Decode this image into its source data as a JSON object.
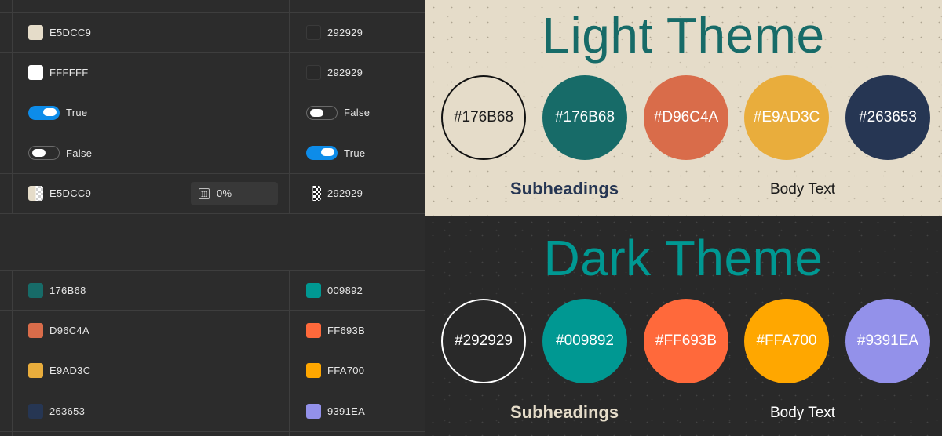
{
  "table": {
    "rows_top": [
      {
        "light": {
          "kind": "color",
          "value": "E5DCC9",
          "swatch": "#e5dcc9"
        },
        "dark": {
          "kind": "color",
          "value": "292929",
          "swatch": "#292929"
        }
      },
      {
        "light": {
          "kind": "color",
          "value": "FFFFFF",
          "swatch": "#ffffff"
        },
        "dark": {
          "kind": "color",
          "value": "292929",
          "swatch": "#292929"
        }
      },
      {
        "light": {
          "kind": "toggle",
          "on": true,
          "value": "True"
        },
        "dark": {
          "kind": "toggle",
          "on": false,
          "value": "False"
        }
      },
      {
        "light": {
          "kind": "toggle",
          "on": false,
          "value": "False"
        },
        "dark": {
          "kind": "toggle",
          "on": true,
          "value": "True"
        }
      },
      {
        "light": {
          "kind": "color-mixed",
          "value": "E5DCC9"
        },
        "opacity": "0%",
        "dark": {
          "kind": "color-mixed",
          "value": "292929"
        }
      }
    ],
    "rows_bottom": [
      {
        "light": {
          "value": "176B68",
          "swatch": "#176b68"
        },
        "dark": {
          "value": "009892",
          "swatch": "#009892"
        }
      },
      {
        "light": {
          "value": "D96C4A",
          "swatch": "#d96c4a"
        },
        "dark": {
          "value": "FF693B",
          "swatch": "#ff693b"
        }
      },
      {
        "light": {
          "value": "E9AD3C",
          "swatch": "#e9ad3c"
        },
        "dark": {
          "value": "FFA700",
          "swatch": "#ffa700"
        }
      },
      {
        "light": {
          "value": "263653",
          "swatch": "#263653"
        },
        "dark": {
          "value": "9391EA",
          "swatch": "#9391ea"
        }
      }
    ]
  },
  "light_theme": {
    "title": "Light Theme",
    "circles": [
      {
        "label": "#176B68",
        "fill": "#e5dcc9",
        "text": "#1a1a1a",
        "ring": "#111111"
      },
      {
        "label": "#176B68",
        "fill": "#176b68",
        "text": "#ffffff"
      },
      {
        "label": "#D96C4A",
        "fill": "#d96c4a",
        "text": "#ffffff"
      },
      {
        "label": "#E9AD3C",
        "fill": "#e9ad3c",
        "text": "#ffffff"
      },
      {
        "label": "#263653",
        "fill": "#263653",
        "text": "#ffffff"
      }
    ],
    "subheadings": "Subheadings",
    "subheadings_color": "#263653",
    "body_text": "Body Text",
    "body_text_color": "#1a1a1a"
  },
  "dark_theme": {
    "title": "Dark Theme",
    "circles": [
      {
        "label": "#292929",
        "fill": "#292929",
        "text": "#ffffff",
        "ring": "#ffffff"
      },
      {
        "label": "#009892",
        "fill": "#009892",
        "text": "#ffffff"
      },
      {
        "label": "#FF693B",
        "fill": "#ff693b",
        "text": "#ffffff"
      },
      {
        "label": "#FFA700",
        "fill": "#ffa700",
        "text": "#ffffff"
      },
      {
        "label": "#9391EA",
        "fill": "#9391ea",
        "text": "#ffffff"
      }
    ],
    "subheadings": "Subheadings",
    "subheadings_color": "#e5dcc9",
    "body_text": "Body Text",
    "body_text_color": "#ffffff"
  }
}
